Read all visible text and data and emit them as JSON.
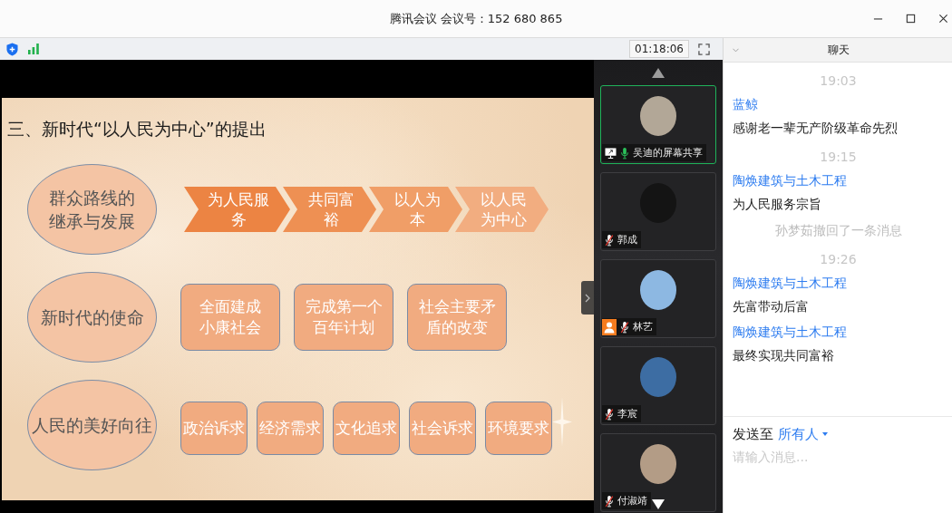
{
  "window": {
    "title": "腾讯会议 会议号：152 680 865"
  },
  "toolbar": {
    "timer": "01:18:06"
  },
  "slide": {
    "title": "三、新时代“以人民为中心”的提出",
    "rows": [
      {
        "topic": "群众路线的继承与发展",
        "kind": "chevrons",
        "items": [
          {
            "text": "为人民服务",
            "color": "#ec8443"
          },
          {
            "text": "共同富裕",
            "color": "#ee9053"
          },
          {
            "text": "以人为本",
            "color": "#f09e67"
          },
          {
            "text": "以人民为中心",
            "color": "#f2ad80"
          }
        ]
      },
      {
        "topic": "新时代的使命",
        "kind": "boxes",
        "items": [
          {
            "text": "全面建成小康社会"
          },
          {
            "text": "完成第一个百年计划"
          },
          {
            "text": "社会主要矛盾的改变"
          }
        ]
      },
      {
        "topic": "人民的美好向往",
        "kind": "tags",
        "items": [
          {
            "text": "政治诉求"
          },
          {
            "text": "经济需求"
          },
          {
            "text": "文化追求"
          },
          {
            "text": "社会诉求"
          },
          {
            "text": "环境要求"
          }
        ]
      }
    ]
  },
  "participants": [
    {
      "name": "吴迪的屏幕共享",
      "selected": true,
      "muted": false,
      "screen_icon": true,
      "person_badge": false
    },
    {
      "name": "郭成",
      "selected": false,
      "muted": true,
      "screen_icon": false,
      "person_badge": false
    },
    {
      "name": "林艺",
      "selected": false,
      "muted": true,
      "screen_icon": false,
      "person_badge": true
    },
    {
      "name": "李宸",
      "selected": false,
      "muted": true,
      "screen_icon": false,
      "person_badge": false
    },
    {
      "name": "付淑靖",
      "selected": false,
      "muted": true,
      "screen_icon": false,
      "person_badge": false
    }
  ],
  "chat": {
    "title": "聊天",
    "entries": [
      {
        "kind": "time",
        "text": "19:03"
      },
      {
        "kind": "message",
        "sender": "蓝鲸",
        "text": "感谢老一辈无产阶级革命先烈"
      },
      {
        "kind": "time",
        "text": "19:15"
      },
      {
        "kind": "message",
        "sender": "陶焕建筑与土木工程",
        "text": "为人民服务宗旨"
      },
      {
        "kind": "notice",
        "text": "孙梦茹撤回了一条消息"
      },
      {
        "kind": "time",
        "text": "19:26"
      },
      {
        "kind": "message",
        "sender": "陶焕建筑与土木工程",
        "text": "先富带动后富"
      },
      {
        "kind": "message",
        "sender": "陶焕建筑与土木工程",
        "text": "最终实现共同富裕"
      }
    ],
    "send_to_label": "发送至",
    "recipient": "所有人",
    "placeholder": "请输入消息..."
  }
}
